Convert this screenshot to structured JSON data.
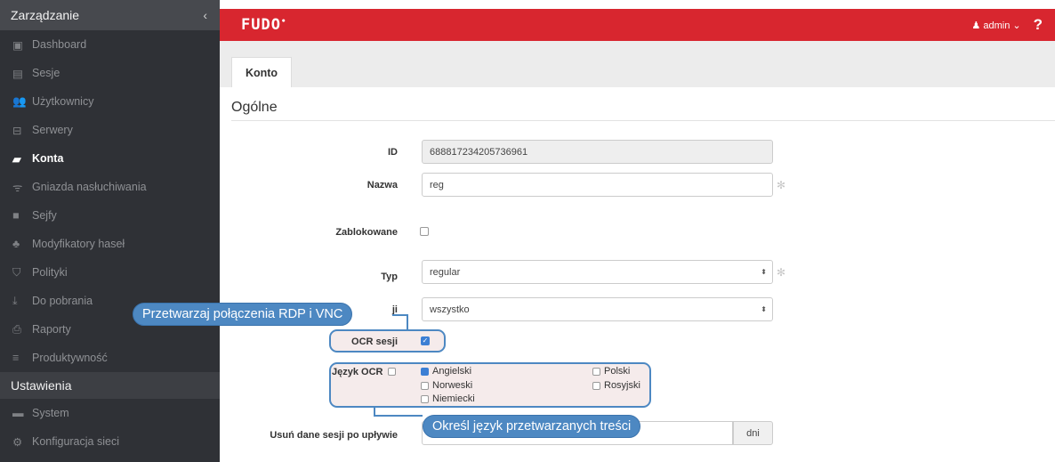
{
  "sidebar": {
    "header": "Zarządzanie",
    "collapse_glyph": "‹",
    "items": [
      {
        "label": "Dashboard",
        "icon": "dashboard-icon",
        "glyph": "▣"
      },
      {
        "label": "Sesje",
        "icon": "film-icon",
        "glyph": "▤"
      },
      {
        "label": "Użytkownicy",
        "icon": "users-icon",
        "glyph": "👥"
      },
      {
        "label": "Serwery",
        "icon": "server-icon",
        "glyph": "⊟"
      },
      {
        "label": "Konta",
        "icon": "book-icon",
        "glyph": "▰",
        "active": true
      },
      {
        "label": "Gniazda nasłuchiwania",
        "icon": "rss-icon",
        "glyph": "ᯤ"
      },
      {
        "label": "Sejfy",
        "icon": "safe-icon",
        "glyph": "■"
      },
      {
        "label": "Modyfikatory haseł",
        "icon": "sitemap-icon",
        "glyph": "♣"
      },
      {
        "label": "Polityki",
        "icon": "shield-icon",
        "glyph": "⛉"
      },
      {
        "label": "Do pobrania",
        "icon": "download-icon",
        "glyph": "⤓"
      },
      {
        "label": "Raporty",
        "icon": "print-icon",
        "glyph": "⎙"
      },
      {
        "label": "Produktywność",
        "icon": "list-icon",
        "glyph": "≡"
      }
    ],
    "section2": "Ustawienia",
    "items2": [
      {
        "label": "System",
        "icon": "folder-icon",
        "glyph": "▬"
      },
      {
        "label": "Konfiguracja sieci",
        "icon": "cogs-icon",
        "glyph": "⚙"
      }
    ]
  },
  "topbar": {
    "logo": "FUDO",
    "logo_mark": "•",
    "user": "admin",
    "user_icon": "user-icon",
    "user_glyph": "♟",
    "user_caret": "⌄",
    "help": "?"
  },
  "tabs": [
    "Konto"
  ],
  "section_title": "Ogólne",
  "form": {
    "id_label": "ID",
    "id_value": "688817234205736961",
    "name_label": "Nazwa",
    "name_value": "reg",
    "blocked_label": "Zablokowane",
    "type_label": "Typ",
    "type_value": "regular",
    "replace_label_tail": "ji",
    "replace_value": "wszystko",
    "ocr_label": "OCR sesji",
    "ocr_lang_label": "Język OCR",
    "languages": [
      "Angielski",
      "Polski",
      "Norweski",
      "Rosyjski",
      "Niemiecki"
    ],
    "delete_label": "Usuń dane sesji po upływie",
    "delete_unit": "dni",
    "required_mark": "✻",
    "select_arrow": "⬍"
  },
  "callouts": {
    "rdp_vnc": "Przetwarzaj połączenia RDP i VNC",
    "language": "Określ język przetwarzanych treści"
  },
  "colors": {
    "accent": "#d8262f",
    "sidebar_bg": "#2f3136",
    "callout": "#4d88c2",
    "checkbox_on": "#3c7fd4"
  }
}
